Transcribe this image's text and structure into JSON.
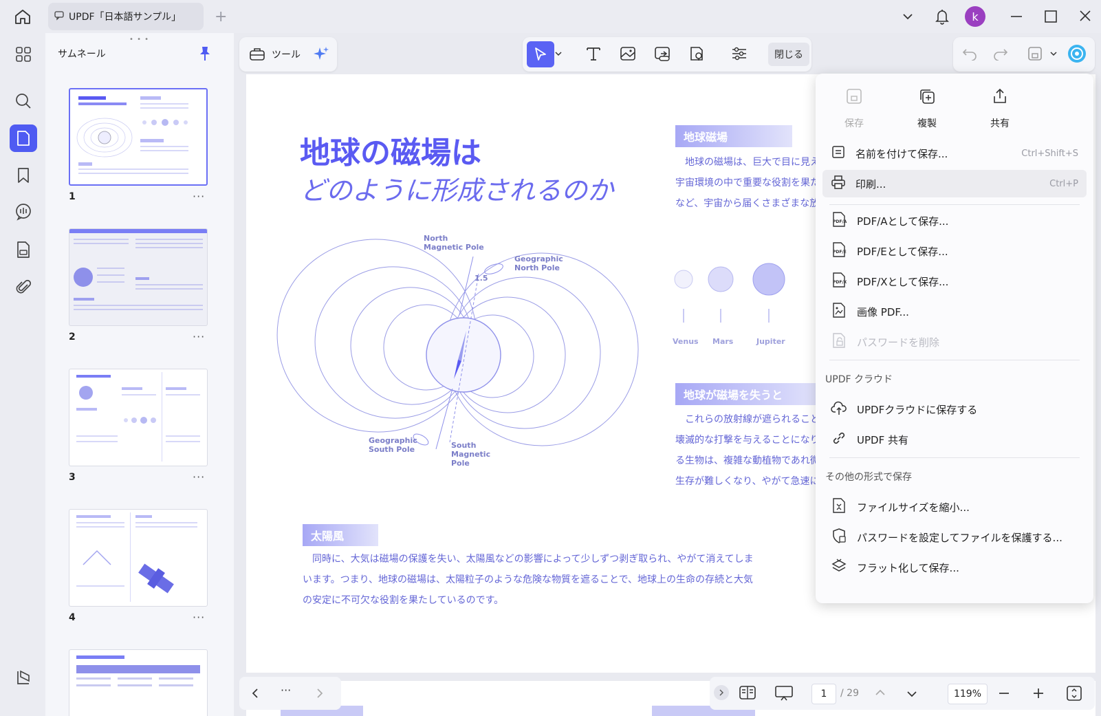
{
  "tab": {
    "title": "UPDF「日本語サンプル」"
  },
  "avatar": {
    "letter": "k"
  },
  "thumbs": {
    "title": "サムネール",
    "pages": [
      "1",
      "2",
      "3",
      "4"
    ],
    "more": "···"
  },
  "toolbar": {
    "tools_label": "ツール",
    "close_label": "閉じる"
  },
  "page": {
    "title": "地球の磁場は",
    "subtitle": "どのように形成されるのか",
    "section1": "地球磁場",
    "section1_lines": [
      "　地球の磁場は、巨大で目に見え",
      "宇宙環境の中で重要な役割を果た",
      "など、宇宙から届くさまざまな放"
    ],
    "planets": [
      "Venus",
      "Mars",
      "Jupiter"
    ],
    "section2": "地球が磁場を失うと",
    "section2_lines": [
      "　これらの放射線が遮られること",
      "壊滅的な打撃を与えることになり",
      "る生物は、複雑な動植物であれ微",
      "生存が難しくなり、やがて急速に"
    ],
    "section3": "太陽風",
    "section3_lines": [
      "　同時に、大気は磁場の保護を失い、太陽風などの影響によって少しずつ剥ぎ取られ、やがて消えてしま",
      "います。つまり、地球の磁場は、太陽粒子のような危険な物質を遮ることで、地球上の生命の存続と大気",
      "の安定に不可欠な役割を果たしているのです。"
    ],
    "diagram": {
      "north_magnetic": [
        "North",
        "Magnetic Pole"
      ],
      "geo_north": [
        "Geographic",
        "North Pole"
      ],
      "angle": "1.5",
      "geo_south": [
        "Geographic",
        "South Pole"
      ],
      "south_magnetic": [
        "South",
        "Magnetic",
        "Pole"
      ]
    }
  },
  "bottom": {
    "page": "1",
    "total": "/ 29",
    "zoom": "119%",
    "more": "···"
  },
  "menu": {
    "save": "保存",
    "duplicate": "複製",
    "share": "共有",
    "items": [
      {
        "label": "名前を付けて保存...",
        "shortcut": "Ctrl+Shift+S"
      },
      {
        "label": "印刷...",
        "shortcut": "Ctrl+P"
      },
      {
        "label": "PDF/Aとして保存..."
      },
      {
        "label": "PDF/Eとして保存..."
      },
      {
        "label": "PDF/Xとして保存..."
      },
      {
        "label": "画像 PDF..."
      },
      {
        "label": "パスワードを削除"
      }
    ],
    "cloud_section": "UPDF クラウド",
    "cloud_items": [
      "UPDFクラウドに保存する",
      "UPDF 共有"
    ],
    "other_section": "その他の形式で保存",
    "other_items": [
      "ファイルサイズを縮小...",
      "パスワードを設定してファイルを保護する...",
      "フラット化して保存..."
    ],
    "icon_text": {
      "pdfa": "PDF/A",
      "pdfe": "PDF/E",
      "pdfx": "PDF/X"
    }
  }
}
